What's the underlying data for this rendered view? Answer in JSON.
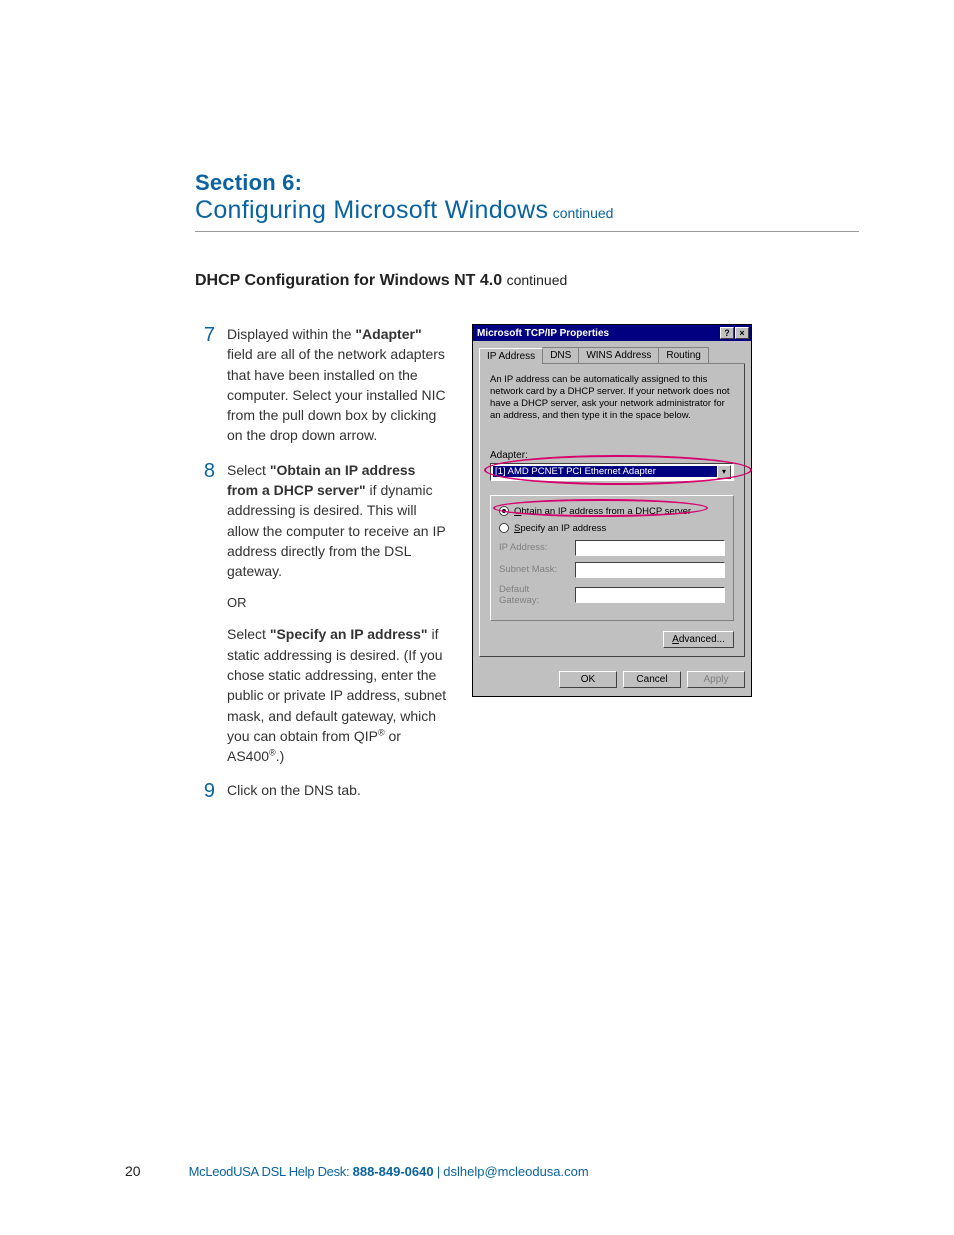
{
  "header": {
    "section_label": "Section 6:",
    "title": "Configuring Microsoft Windows",
    "continued": "continued"
  },
  "subheading": {
    "title": "DHCP Configuration for Windows NT 4.0",
    "continued": "continued"
  },
  "steps": {
    "s7": {
      "num": "7",
      "pre": "Displayed within the ",
      "bold": "\"Adapter\"",
      "post": " field are all of the network adapters that have been installed on the computer. Select your installed NIC from the pull down box by clicking on the drop down arrow."
    },
    "s8": {
      "num": "8",
      "a_pre": "Select ",
      "a_bold": "\"Obtain an IP address from a DHCP server\"",
      "a_post": " if dynamic addressing is desired. This will allow the computer to receive an IP address directly from the DSL gateway.",
      "or": "OR",
      "b_pre": "Select ",
      "b_bold": "\"Specify an IP address\"",
      "b_post": " if static addressing is desired. (If you chose static addressing, enter the public or private IP address, subnet mask, and default gateway, which you can obtain from QIP",
      "b_tail": " or AS400",
      "b_end": ".)"
    },
    "s9": {
      "num": "9",
      "text": "Click on the DNS tab."
    }
  },
  "dialog": {
    "title": "Microsoft TCP/IP Properties",
    "help_btn": "?",
    "close_btn": "×",
    "tabs": {
      "ip": "IP Address",
      "dns": "DNS",
      "wins": "WINS Address",
      "routing": "Routing"
    },
    "description": "An IP address can be automatically assigned to this network card by a DHCP server. If your network does not have a DHCP server, ask your network administrator for an address, and then type it in the space below.",
    "adapter_label": "Adapter:",
    "adapter_value": "[1] AMD PCNET PCI Ethernet Adapter",
    "dropdown_arrow": "▾",
    "radio_obtain_pre": "O",
    "radio_obtain_rest": "btain an IP address from a DHCP server",
    "radio_specify_pre": "S",
    "radio_specify_rest": "pecify an IP address",
    "fields": {
      "ip": "IP Address:",
      "subnet": "Subnet Mask:",
      "gateway": "Default Gateway:"
    },
    "advanced_pre": "A",
    "advanced_rest": "dvanced...",
    "ok": "OK",
    "cancel": "Cancel",
    "apply": "Apply"
  },
  "footer": {
    "page": "20",
    "brand": "McLeodUSA DSL Help Desk: ",
    "phone": "888-849-0640",
    "sep": "  |  ",
    "email": "dslhelp@mcleodusa.com"
  },
  "reg": "®"
}
